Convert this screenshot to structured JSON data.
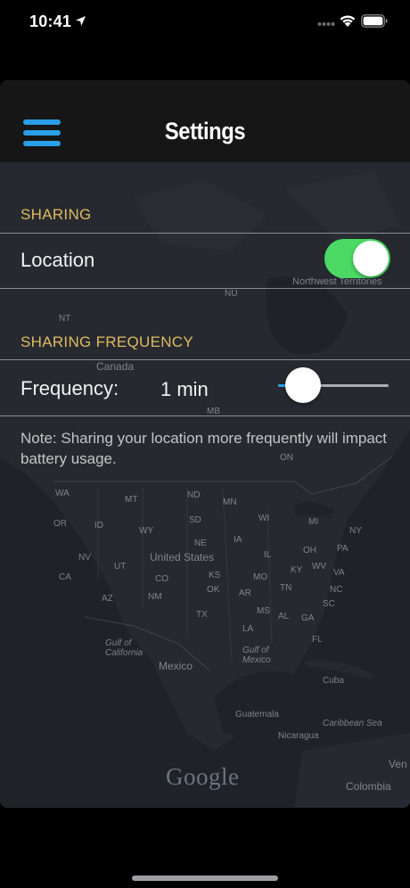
{
  "status_bar": {
    "time": "10:41"
  },
  "nav": {
    "title": "Settings",
    "menu_icon": "hamburger-icon"
  },
  "sections": {
    "sharing": {
      "header": "SHARING",
      "location_label": "Location",
      "location_enabled": true
    },
    "frequency": {
      "header": "SHARING FREQUENCY",
      "label": "Frequency:",
      "value": "1 min",
      "slider_fraction": 0.1,
      "note": "Note: Sharing your location more frequently will impact battery usage."
    }
  },
  "map": {
    "labels": [
      {
        "text": "Northwest Territories"
      },
      {
        "text": "NU"
      },
      {
        "text": "NT"
      },
      {
        "text": "Canada"
      },
      {
        "text": "MB"
      },
      {
        "text": "ON"
      },
      {
        "text": "WA"
      },
      {
        "text": "MT"
      },
      {
        "text": "ND"
      },
      {
        "text": "MN"
      },
      {
        "text": "OR"
      },
      {
        "text": "ID"
      },
      {
        "text": "WY"
      },
      {
        "text": "SD"
      },
      {
        "text": "WI"
      },
      {
        "text": "MI"
      },
      {
        "text": "NE"
      },
      {
        "text": "IA"
      },
      {
        "text": "NV"
      },
      {
        "text": "UT"
      },
      {
        "text": "United States"
      },
      {
        "text": "IL"
      },
      {
        "text": "OH"
      },
      {
        "text": "PA"
      },
      {
        "text": "NY"
      },
      {
        "text": "CA"
      },
      {
        "text": "CO"
      },
      {
        "text": "KS"
      },
      {
        "text": "MO"
      },
      {
        "text": "KY"
      },
      {
        "text": "WV"
      },
      {
        "text": "VA"
      },
      {
        "text": "AZ"
      },
      {
        "text": "NM"
      },
      {
        "text": "OK"
      },
      {
        "text": "AR"
      },
      {
        "text": "TN"
      },
      {
        "text": "NC"
      },
      {
        "text": "MS"
      },
      {
        "text": "AL"
      },
      {
        "text": "GA"
      },
      {
        "text": "SC"
      },
      {
        "text": "TX"
      },
      {
        "text": "LA"
      },
      {
        "text": "FL"
      },
      {
        "text": "Gulf of California"
      },
      {
        "text": "Mexico"
      },
      {
        "text": "Gulf of Mexico"
      },
      {
        "text": "Cuba"
      },
      {
        "text": "Guatemala"
      },
      {
        "text": "Nicaragua"
      },
      {
        "text": "Caribbean Sea"
      },
      {
        "text": "Colombia"
      },
      {
        "text": "Ven"
      }
    ],
    "attribution": "Google"
  },
  "colors": {
    "accent": "#2a9ee6",
    "section_header": "#e1b95f",
    "toggle_on": "#4cd964",
    "nav_bg": "#161616"
  }
}
